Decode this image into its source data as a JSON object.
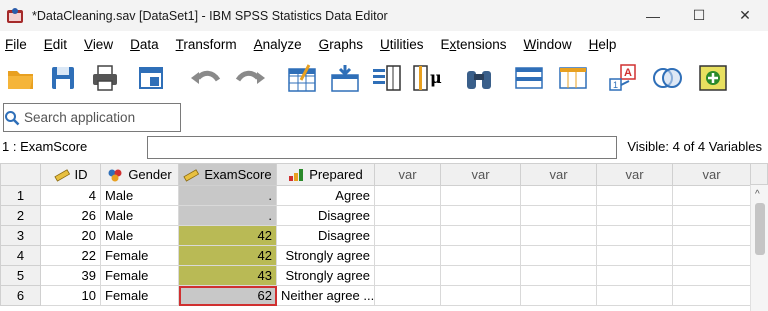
{
  "window": {
    "title": "*DataCleaning.sav [DataSet1] - IBM SPSS Statistics Data Editor",
    "minimize": "—",
    "maximize": "☐",
    "close": "✕"
  },
  "menu": [
    {
      "label": "File",
      "u": "F",
      "rest": "ile"
    },
    {
      "label": "Edit",
      "u": "E",
      "rest": "dit"
    },
    {
      "label": "View",
      "u": "V",
      "rest": "iew"
    },
    {
      "label": "Data",
      "u": "D",
      "rest": "ata"
    },
    {
      "label": "Transform",
      "u": "T",
      "rest": "ransform"
    },
    {
      "label": "Analyze",
      "u": "A",
      "rest": "nalyze"
    },
    {
      "label": "Graphs",
      "u": "G",
      "rest": "raphs"
    },
    {
      "label": "Utilities",
      "u": "U",
      "rest": "tilities"
    },
    {
      "label": "Extensions",
      "pre": "E",
      "u": "x",
      "rest": "tensions"
    },
    {
      "label": "Window",
      "u": "W",
      "rest": "indow"
    },
    {
      "label": "Help",
      "u": "H",
      "rest": "elp"
    }
  ],
  "toolbar": {
    "icons": [
      "open-folder-icon",
      "save-icon",
      "print-icon",
      "dialog-recall-icon",
      "undo-icon",
      "redo-icon",
      "goto-case-icon",
      "goto-variable-icon",
      "variables-icon",
      "run-descriptives-icon",
      "find-icon",
      "insert-cases-icon",
      "insert-variable-icon",
      "value-labels-icon",
      "use-variable-sets-icon",
      "show-all-variables-icon"
    ]
  },
  "search": {
    "placeholder": "Search application"
  },
  "cell_editor": {
    "reference": "1 : ExamScore",
    "value": "",
    "visible": "Visible: 4 of 4 Variables"
  },
  "grid": {
    "columns": [
      {
        "label": "ID",
        "icon": "scale-ruler-icon"
      },
      {
        "label": "Gender",
        "icon": "nominal-icon"
      },
      {
        "label": "ExamScore",
        "icon": "scale-ruler-icon"
      },
      {
        "label": "Prepared",
        "icon": "ordinal-bars-icon"
      },
      {
        "label": "var"
      },
      {
        "label": "var"
      },
      {
        "label": "var"
      },
      {
        "label": "var"
      },
      {
        "label": "var"
      }
    ],
    "rows": [
      {
        "n": "1",
        "id": "4",
        "gender": "Male",
        "score": ".",
        "prepared": "Agree"
      },
      {
        "n": "2",
        "id": "26",
        "gender": "Male",
        "score": ".",
        "prepared": "Disagree"
      },
      {
        "n": "3",
        "id": "20",
        "gender": "Male",
        "score": "42",
        "prepared": "Disagree"
      },
      {
        "n": "4",
        "id": "22",
        "gender": "Female",
        "score": "42",
        "prepared": "Strongly agree"
      },
      {
        "n": "5",
        "id": "39",
        "gender": "Female",
        "score": "43",
        "prepared": "Strongly agree"
      },
      {
        "n": "6",
        "id": "10",
        "gender": "Female",
        "score": "62",
        "prepared": "Neither agree ..."
      }
    ]
  },
  "colors": {
    "highlight": "#b9ba55",
    "selected": "#c8c8c8",
    "active_border": "#d03030"
  }
}
